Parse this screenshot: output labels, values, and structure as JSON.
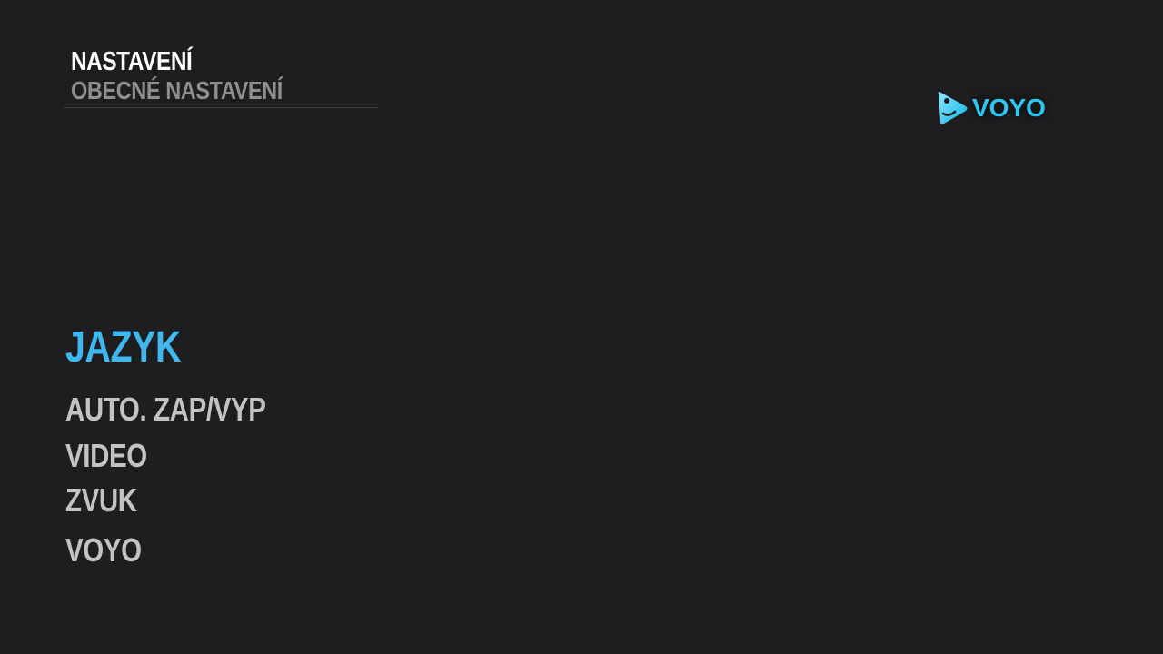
{
  "header": {
    "title": "NASTAVENÍ",
    "subtitle": "OBECNÉ NASTAVENÍ"
  },
  "logo": {
    "icon": "voyo-play-icon",
    "text": "VOYO",
    "color": "#2fc7ef"
  },
  "menu": {
    "items": [
      {
        "label": "JAZYK",
        "active": true
      },
      {
        "label": "AUTO. ZAP/VYP",
        "active": false
      },
      {
        "label": "VIDEO",
        "active": false
      },
      {
        "label": "ZVUK",
        "active": false
      },
      {
        "label": "VOYO",
        "active": false
      }
    ]
  },
  "colors": {
    "background": "#1e1e20",
    "accent": "#3fb8f1",
    "menu_text": "#c3c3c5",
    "subtitle_text": "#8e8e90",
    "title_text": "#ffffff"
  }
}
